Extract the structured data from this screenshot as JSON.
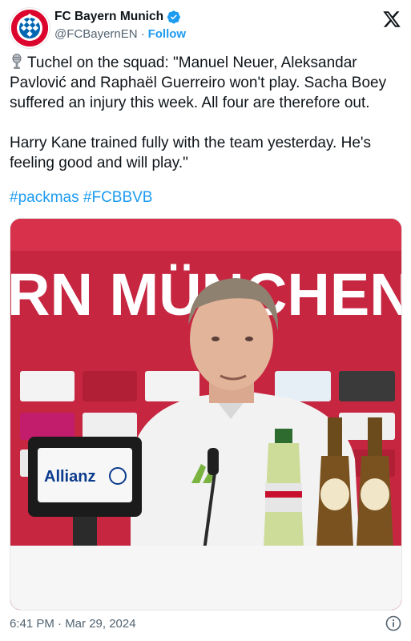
{
  "account": {
    "name": "FC Bayern Munich",
    "handle": "@FCBayernEN",
    "separator": "·",
    "follow_label": "Follow",
    "avatar_icon": "fc-bayern-logo",
    "verified_icon": "verified-badge-icon"
  },
  "tweet": {
    "emoji_icon": "microphone-icon",
    "paragraph1": "Tuchel on the squad: \"Manuel Neuer, Aleksandar Pavlović and Raphaël Guerreiro won't play. Sacha Boey suffered an injury this week. All four are therefore out.",
    "paragraph2": "Harry Kane trained fully with the team yesterday. He's feeling good and will play.\"",
    "hashtags": [
      "#packmas",
      "#FCBBVB"
    ]
  },
  "media": {
    "backdrop_text": "RN MÜNCHEN",
    "sign_text": "Allianz"
  },
  "footer": {
    "timestamp": "6:41 PM · Mar 29, 2024"
  },
  "colors": {
    "accent": "#1d9bf0",
    "bayern_red": "#dc052d",
    "text": "#0f1419",
    "muted": "#536471"
  }
}
